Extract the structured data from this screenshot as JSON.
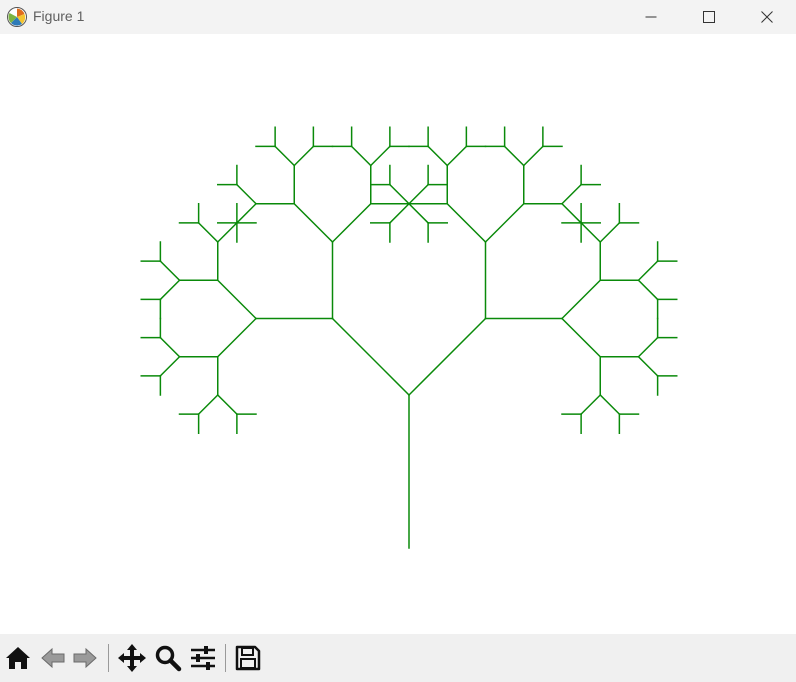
{
  "window": {
    "title": "Figure 1"
  },
  "icons": {
    "app": "matplotlib-figure-icon",
    "minimize": "minimize-icon",
    "maximize": "maximize-icon",
    "close": "close-icon"
  },
  "toolbar": {
    "tools": [
      "home-icon",
      "back-arrow-icon",
      "forward-arrow-icon",
      "pan-move-icon",
      "zoom-magnifier-icon",
      "configure-subplots-icon",
      "save-floppy-icon"
    ],
    "disabled": [
      "back-arrow-icon",
      "forward-arrow-icon"
    ]
  },
  "colors": {
    "tree_line": "#0a8a0a",
    "titlebar_bg": "#f3f3f3",
    "toolbar_bg": "#f0f0f0"
  },
  "chart_data": {
    "type": "line",
    "description_kind": "recursive fractal tree",
    "levels": 6,
    "branch_angle_deg": 45,
    "length_ratio": 0.7071,
    "axes_visible": false,
    "grid": false
  }
}
